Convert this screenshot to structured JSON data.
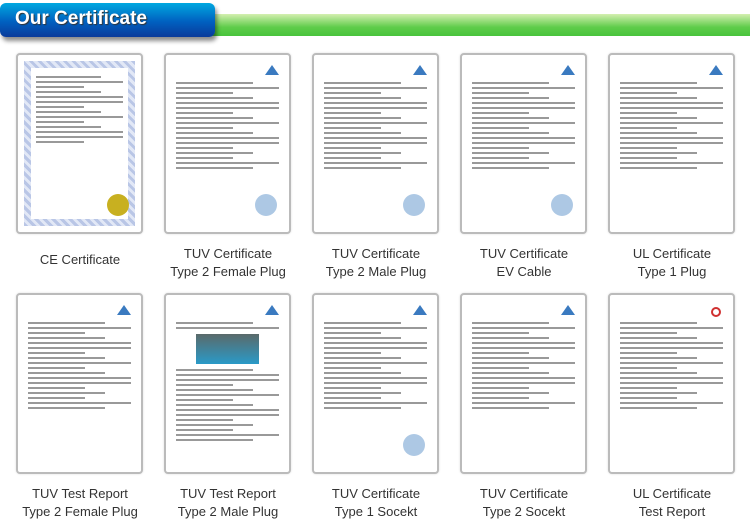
{
  "header": {
    "title": "Our Certificate"
  },
  "certificates": [
    {
      "line1": "CE Certificate",
      "line2": ""
    },
    {
      "line1": "TUV Certificate",
      "line2": "Type 2 Female Plug"
    },
    {
      "line1": "TUV Certificate",
      "line2": "Type 2 Male Plug"
    },
    {
      "line1": "TUV Certificate",
      "line2": "EV Cable"
    },
    {
      "line1": "UL Certificate",
      "line2": "Type 1 Plug"
    },
    {
      "line1": "TUV Test Report",
      "line2": "Type 2 Female Plug"
    },
    {
      "line1": "TUV Test Report",
      "line2": "Type 2 Male Plug"
    },
    {
      "line1": "TUV Certificate",
      "line2": "Type 1 Socekt"
    },
    {
      "line1": "TUV Certificate",
      "line2": "Type 2 Socekt"
    },
    {
      "line1": "UL Certificate",
      "line2": "Test Report"
    }
  ],
  "colors": {
    "header_blue": "#0060c0",
    "bar_green": "#48c43c"
  }
}
